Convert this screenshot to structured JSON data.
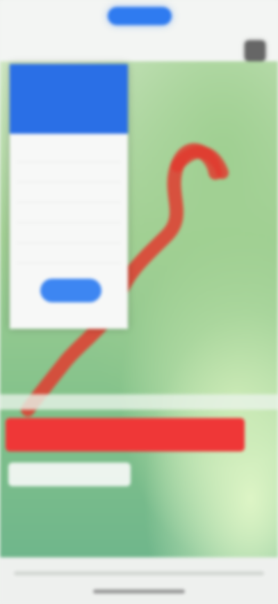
{
  "tabs": [
    {
      "label": ""
    },
    {
      "label": ""
    },
    {
      "label": ""
    }
  ],
  "header": {
    "subtitle": ""
  },
  "panel": {
    "title": "",
    "subtitle": "",
    "rows": [
      {
        "label": "",
        "value": ""
      },
      {
        "label": "",
        "value": ""
      },
      {
        "label": "",
        "value": ""
      },
      {
        "label": "",
        "value": ""
      },
      {
        "label": "",
        "value": ""
      },
      {
        "label": "",
        "value": ""
      }
    ],
    "button_label": ""
  },
  "map": {
    "route_color": "#e03b2f",
    "alert_color": "#ef3737"
  },
  "alert": {
    "text": ""
  },
  "info": {
    "text": ""
  }
}
